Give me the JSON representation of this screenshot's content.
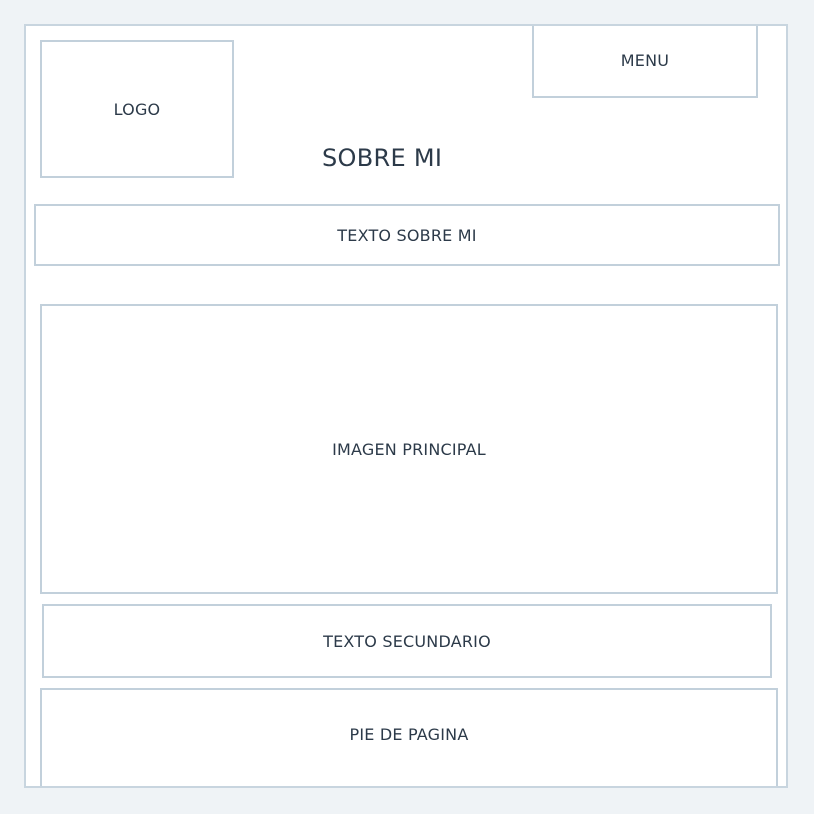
{
  "header": {
    "logo_label": "LOGO",
    "menu_label": "MENU"
  },
  "page_title": "SOBRE MI",
  "about_text": "TEXTO SOBRE MI",
  "main_image_label": "IMAGEN PRINCIPAL",
  "secondary_text": "TEXTO SECUNDARIO",
  "footer_label": "PIE DE PAGINA",
  "colors": {
    "background": "#eff3f6",
    "frame": "#ffffff",
    "border": "#c2d0db",
    "text": "#2c3a49"
  }
}
